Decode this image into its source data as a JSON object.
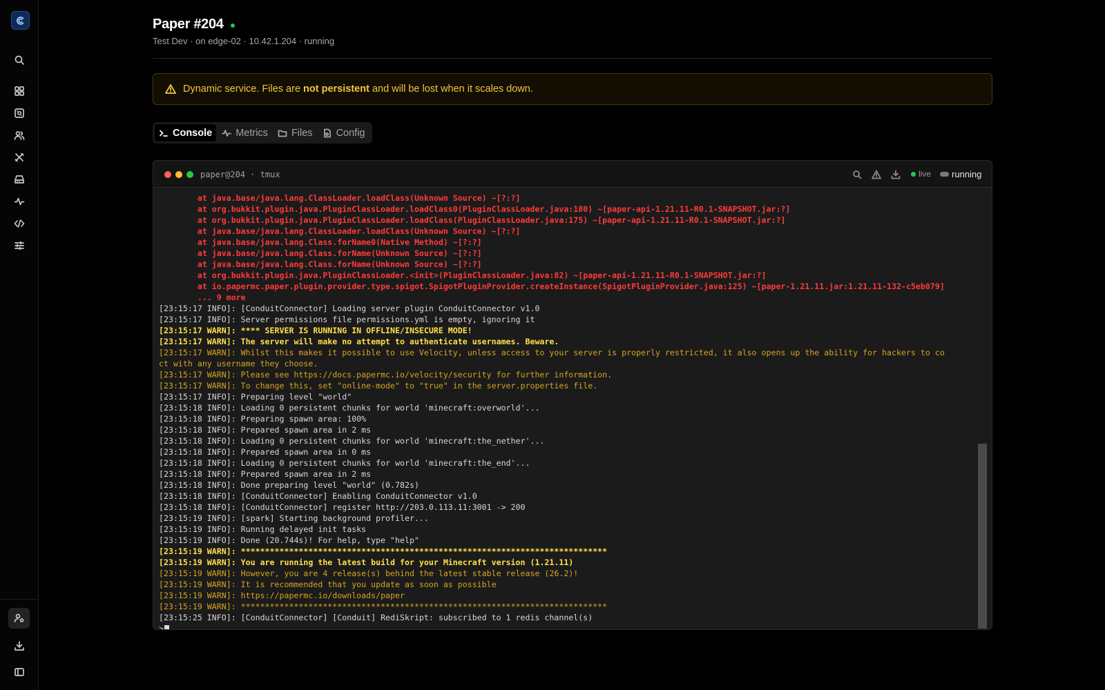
{
  "sidebar": {
    "logo_icon": "conduit-logo-icon",
    "items": [
      {
        "name": "search",
        "icon": "search-icon"
      },
      {
        "name": "dashboard",
        "icon": "dashboard-icon"
      },
      {
        "name": "servers",
        "icon": "server-icon"
      },
      {
        "name": "users",
        "icon": "users-icon"
      },
      {
        "name": "tools",
        "icon": "tools-icon"
      },
      {
        "name": "storage",
        "icon": "storage-icon"
      },
      {
        "name": "activity",
        "icon": "activity-icon"
      },
      {
        "name": "code",
        "icon": "code-icon"
      },
      {
        "name": "settings",
        "icon": "sliders-icon"
      }
    ],
    "bottom": [
      {
        "name": "account",
        "icon": "user-settings-icon"
      },
      {
        "name": "downloads",
        "icon": "download-icon"
      },
      {
        "name": "collapse",
        "icon": "sidebar-toggle-icon"
      }
    ]
  },
  "header": {
    "title": "Paper #204",
    "subtitle": "Test Dev · on edge-02 · 10.42.1.204 · running",
    "status_color": "#22c55e"
  },
  "banner": {
    "icon": "warning-triangle-icon",
    "text_before": "Dynamic service. Files are ",
    "text_bold": "not persistent",
    "text_after": " and will be lost when it scales down."
  },
  "tabs": [
    {
      "label": "Console",
      "icon": "terminal-icon",
      "active": true
    },
    {
      "label": "Metrics",
      "icon": "activity-icon",
      "active": false
    },
    {
      "label": "Files",
      "icon": "folder-icon",
      "active": false
    },
    {
      "label": "Config",
      "icon": "config-file-icon",
      "active": false
    }
  ],
  "terminal": {
    "title": "paper@204 · tmux",
    "live_label": "live",
    "status_label": "running",
    "lights": [
      "#ff5f57",
      "#febc2e",
      "#28c840"
    ],
    "lines": [
      {
        "t": "stack",
        "text": "        at java.base/java.lang.ClassLoader.loadClass(Unknown Source) ~[?:?]"
      },
      {
        "t": "stack",
        "text": "        at org.bukkit.plugin.java.PluginClassLoader.loadClass0(PluginClassLoader.java:180) ~[paper-api-1.21.11-R0.1-SNAPSHOT.jar:?]"
      },
      {
        "t": "stack",
        "text": "        at org.bukkit.plugin.java.PluginClassLoader.loadClass(PluginClassLoader.java:175) ~[paper-api-1.21.11-R0.1-SNAPSHOT.jar:?]"
      },
      {
        "t": "stack",
        "text": "        at java.base/java.lang.ClassLoader.loadClass(Unknown Source) ~[?:?]"
      },
      {
        "t": "stack",
        "text": "        at java.base/java.lang.Class.forName0(Native Method) ~[?:?]"
      },
      {
        "t": "stack",
        "text": "        at java.base/java.lang.Class.forName(Unknown Source) ~[?:?]"
      },
      {
        "t": "stack",
        "text": "        at java.base/java.lang.Class.forName(Unknown Source) ~[?:?]"
      },
      {
        "t": "stack",
        "text": "        at org.bukkit.plugin.java.PluginClassLoader.<init>(PluginClassLoader.java:82) ~[paper-api-1.21.11-R0.1-SNAPSHOT.jar:?]"
      },
      {
        "t": "stack",
        "text": "        at io.papermc.paper.plugin.provider.type.spigot.SpigotPluginProvider.createInstance(SpigotPluginProvider.java:125) ~[paper-1.21.11.jar:1.21.11-132-c5eb079]"
      },
      {
        "t": "stack",
        "text": "        ... 9 more"
      },
      {
        "t": "info",
        "text": "[23:15:17 INFO]: [ConduitConnector] Loading server plugin ConduitConnector v1.0"
      },
      {
        "t": "info",
        "text": "[23:15:17 INFO]: Server permissions file permissions.yml is empty, ignoring it"
      },
      {
        "t": "warn-b",
        "text": "[23:15:17 WARN]: **** SERVER IS RUNNING IN OFFLINE/INSECURE MODE!"
      },
      {
        "t": "warn-b",
        "text": "[23:15:17 WARN]: The server will make no attempt to authenticate usernames. Beware."
      },
      {
        "t": "warn",
        "text": "[23:15:17 WARN]: Whilst this makes it possible to use Velocity, unless access to your server is properly restricted, it also opens up the ability for hackers to co"
      },
      {
        "t": "warn",
        "text": "ct with any username they choose."
      },
      {
        "t": "warn",
        "text": "[23:15:17 WARN]: Please see https://docs.papermc.io/velocity/security for further information."
      },
      {
        "t": "warn",
        "text": "[23:15:17 WARN]: To change this, set \"online-mode\" to \"true\" in the server.properties file."
      },
      {
        "t": "info",
        "text": "[23:15:17 INFO]: Preparing level \"world\""
      },
      {
        "t": "info",
        "text": "[23:15:18 INFO]: Loading 0 persistent chunks for world 'minecraft:overworld'..."
      },
      {
        "t": "info",
        "text": "[23:15:18 INFO]: Preparing spawn area: 100%"
      },
      {
        "t": "info",
        "text": "[23:15:18 INFO]: Prepared spawn area in 2 ms"
      },
      {
        "t": "info",
        "text": "[23:15:18 INFO]: Loading 0 persistent chunks for world 'minecraft:the_nether'..."
      },
      {
        "t": "info",
        "text": "[23:15:18 INFO]: Prepared spawn area in 0 ms"
      },
      {
        "t": "info",
        "text": "[23:15:18 INFO]: Loading 0 persistent chunks for world 'minecraft:the_end'..."
      },
      {
        "t": "info",
        "text": "[23:15:18 INFO]: Prepared spawn area in 2 ms"
      },
      {
        "t": "info",
        "text": "[23:15:18 INFO]: Done preparing level \"world\" (0.782s)"
      },
      {
        "t": "info",
        "text": "[23:15:18 INFO]: [ConduitConnector] Enabling ConduitConnector v1.0"
      },
      {
        "t": "info",
        "text": "[23:15:18 INFO]: [ConduitConnector] register http://203.0.113.11:3001 -> 200"
      },
      {
        "t": "info",
        "text": "[23:15:19 INFO]: [spark] Starting background profiler..."
      },
      {
        "t": "info",
        "text": "[23:15:19 INFO]: Running delayed init tasks"
      },
      {
        "t": "info",
        "text": "[23:15:19 INFO]: Done (20.744s)! For help, type \"help\""
      },
      {
        "t": "warn-b",
        "text": "[23:15:19 WARN]: ****************************************************************************"
      },
      {
        "t": "warn-b",
        "text": "[23:15:19 WARN]: You are running the latest build for your Minecraft version (1.21.11)"
      },
      {
        "t": "warn",
        "text": "[23:15:19 WARN]: However, you are 4 release(s) behind the latest stable release (26.2)!"
      },
      {
        "t": "warn",
        "text": "[23:15:19 WARN]: It is recommended that you update as soon as possible"
      },
      {
        "t": "warn",
        "text": "[23:15:19 WARN]: https://papermc.io/downloads/paper"
      },
      {
        "t": "warn",
        "text": "[23:15:19 WARN]: ****************************************************************************"
      },
      {
        "t": "info",
        "text": "[23:15:25 INFO]: [ConduitConnector] [Conduit] RediSkript: subscribed to 1 redis channel(s)"
      }
    ],
    "prompt": ">"
  }
}
